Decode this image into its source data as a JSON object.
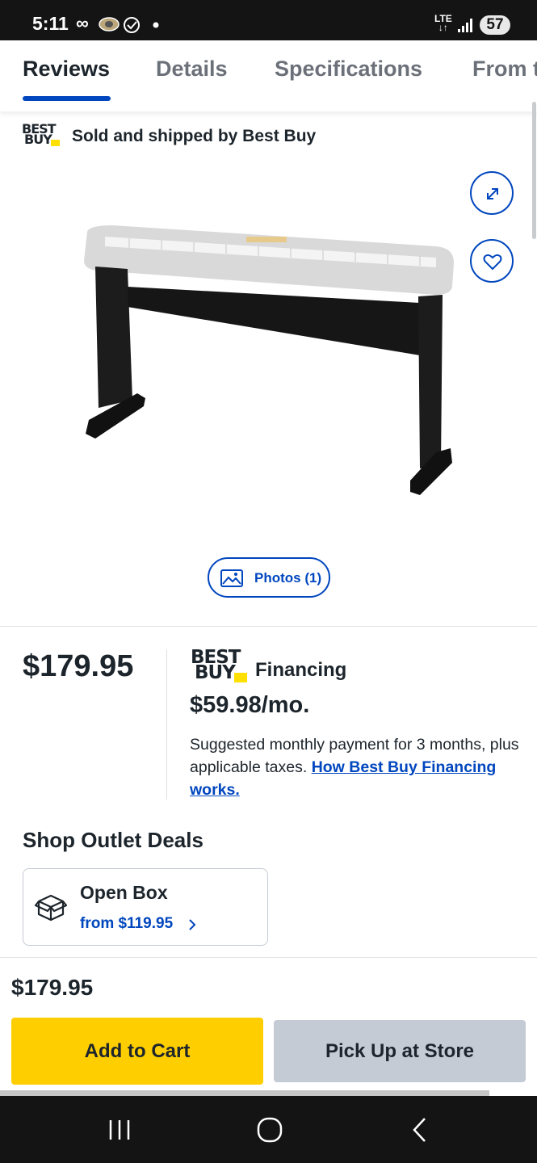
{
  "status_bar": {
    "time": "5:11",
    "network": "LTE",
    "battery": "57",
    "icons": [
      "infinity-icon",
      "coin-icon",
      "check-circle-icon",
      "dot-icon",
      "signal-icon"
    ]
  },
  "tabs": [
    {
      "label": "Reviews",
      "active": true
    },
    {
      "label": "Details",
      "active": false
    },
    {
      "label": "Specifications",
      "active": false
    },
    {
      "label": "From t",
      "active": false
    }
  ],
  "seller": {
    "logo_line1": "BEST",
    "logo_line2": "BUY",
    "text": "Sold and shipped by Best Buy"
  },
  "gallery": {
    "photos_label": "Photos (1)",
    "image_icon": "piano-stand-image"
  },
  "pricing": {
    "price": "$179.95",
    "financing_logo_line1": "BEST",
    "financing_logo_line2": "BUY",
    "financing_label": "Financing",
    "monthly": "$59.98/mo.",
    "description": "Suggested monthly payment for 3 months, plus applicable taxes.",
    "link_text": "How Best Buy Financing works."
  },
  "outlet": {
    "heading": "Shop Outlet Deals",
    "open_box_title": "Open Box",
    "open_box_price": "from $119.95"
  },
  "bottom_bar": {
    "price": "$179.95",
    "add_to_cart": "Add to Cart",
    "pickup": "Pick Up at Store"
  },
  "colors": {
    "brand_blue": "#0046be",
    "cart_yellow": "#ffce00",
    "pickup_gray": "#c5cbd5",
    "logo_tag_yellow": "#ffe000"
  }
}
